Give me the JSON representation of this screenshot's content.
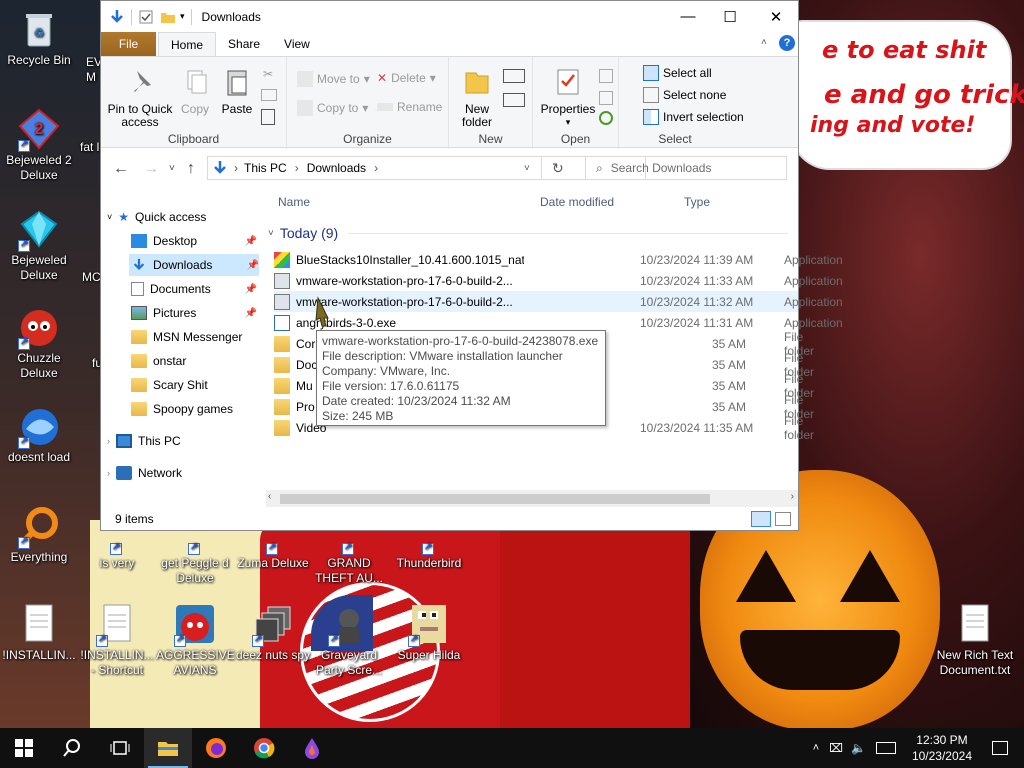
{
  "desktop": {
    "wallpaper_text": [
      "e to eat shit",
      "e and go trick",
      "ing and vote!"
    ],
    "icons": [
      {
        "label": "Recycle Bin"
      },
      {
        "label": "EV M"
      },
      {
        "label": "Bejeweled 2 Deluxe"
      },
      {
        "label": "fat l"
      },
      {
        "label": "Bejeweled Deluxe"
      },
      {
        "label": "MC"
      },
      {
        "label": "Chuzzle Deluxe"
      },
      {
        "label": "fu"
      },
      {
        "label": "doesnt load"
      },
      {
        "label": "Everything"
      },
      {
        "label": "is very"
      },
      {
        "label": "get Peggle d Deluxe"
      },
      {
        "label": "Zuma Deluxe"
      },
      {
        "label": "GRAND THEFT AU..."
      },
      {
        "label": "Thunderbird"
      },
      {
        "label": "!INSTALLIN..."
      },
      {
        "label": "!INSTALLIN... - Shortcut"
      },
      {
        "label": "AGGRESSIVE AVIANS"
      },
      {
        "label": "deez nuts spy"
      },
      {
        "label": "Graveyard Party Scre..."
      },
      {
        "label": "Super Hilda"
      },
      {
        "label": "New Rich Text Document.txt"
      }
    ]
  },
  "window": {
    "title": "Downloads",
    "controls": {
      "minimize": "—",
      "maximize": "☐",
      "close": "✕"
    },
    "tabs": [
      "File",
      "Home",
      "Share",
      "View"
    ],
    "ribbon": {
      "clipboard": {
        "label": "Clipboard",
        "pin": "Pin to Quick access",
        "copy": "Copy",
        "paste": "Paste"
      },
      "organize": {
        "label": "Organize",
        "move_to": "Move to",
        "copy_to": "Copy to",
        "delete": "Delete",
        "rename": "Rename"
      },
      "new": {
        "label": "New",
        "new_folder": "New folder"
      },
      "open": {
        "label": "Open",
        "properties": "Properties"
      },
      "select": {
        "label": "Select",
        "select_all": "Select all",
        "select_none": "Select none",
        "invert": "Invert selection"
      }
    },
    "address": {
      "path": [
        "This PC",
        "Downloads"
      ],
      "search_placeholder": "Search Downloads"
    },
    "nav": {
      "quick_access": "Quick access",
      "items": [
        "Desktop",
        "Downloads",
        "Documents",
        "Pictures",
        "MSN Messenger",
        "onstar",
        "Scary Shit",
        "Spoopy games"
      ],
      "this_pc": "This PC",
      "network": "Network"
    },
    "columns": {
      "name": "Name",
      "date": "Date modified",
      "type": "Type"
    },
    "group": "Today (9)",
    "files": [
      {
        "name": "BlueStacks10Installer_10.41.600.1015_nati...",
        "date": "10/23/2024 11:39 AM",
        "type": "Application"
      },
      {
        "name": "vmware-workstation-pro-17-6-0-build-2...",
        "date": "10/23/2024 11:33 AM",
        "type": "Application"
      },
      {
        "name": "vmware-workstation-pro-17-6-0-build-2...",
        "date": "10/23/2024 11:32 AM",
        "type": "Application"
      },
      {
        "name": "angrybirds-3-0.exe",
        "date": "10/23/2024 11:31 AM",
        "type": "Application"
      },
      {
        "name": "Cor",
        "date": "35 AM",
        "type": "File folder"
      },
      {
        "name": "Doc",
        "date": "35 AM",
        "type": "File folder"
      },
      {
        "name": "Mu",
        "date": "35 AM",
        "type": "File folder"
      },
      {
        "name": "Pro",
        "date": "35 AM",
        "type": "File folder"
      },
      {
        "name": "Video",
        "date": "10/23/2024 11:35 AM",
        "type": "File folder"
      }
    ],
    "tooltip": [
      "vmware-workstation-pro-17-6-0-build-24238078.exe",
      "File description: VMware installation launcher",
      "Company: VMware, Inc.",
      "File version: 17.6.0.61175",
      "Date created: 10/23/2024 11:32 AM",
      "Size: 245 MB"
    ],
    "status": "9 items"
  },
  "taskbar": {
    "time": "12:30 PM",
    "date": "10/23/2024"
  }
}
